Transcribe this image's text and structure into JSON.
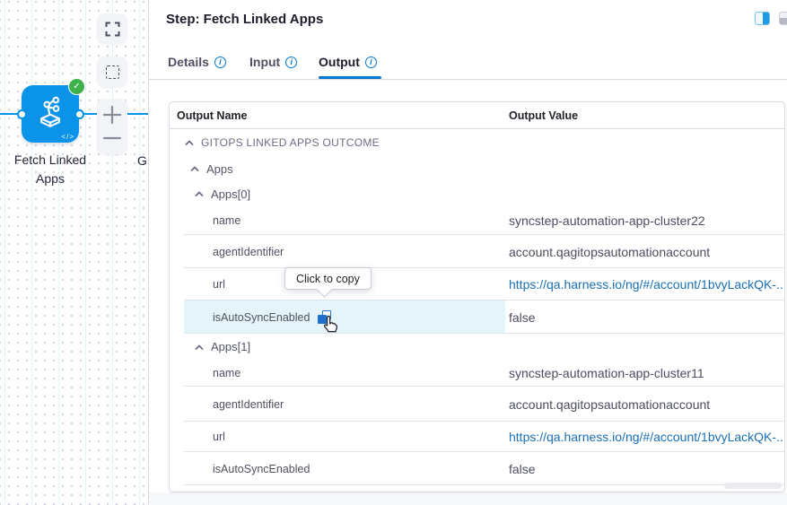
{
  "header": {
    "title": "Step: Fetch Linked Apps"
  },
  "tabs": [
    {
      "label": "Details"
    },
    {
      "label": "Input"
    },
    {
      "label": "Output",
      "active": true
    }
  ],
  "top_icons": {
    "split_pane_blue": "pane-toggle-active",
    "split_pane_grey": "pane-toggle-inactive"
  },
  "canvas": {
    "node_label": "Fetch Linked Apps",
    "node_status": "success",
    "next_node_label_partial": "G",
    "node_code_glyph": "</>",
    "toolbar_icons": [
      "fullscreen-icon",
      "marquee-select-icon",
      "zoom-in-icon",
      "zoom-out-icon"
    ]
  },
  "table": {
    "columns": {
      "name": "Output Name",
      "value": "Output Value"
    },
    "rows": [
      {
        "type": "group",
        "level": 1,
        "label": "GITOPS LINKED APPS OUTCOME"
      },
      {
        "type": "group",
        "level": 2,
        "label": "Apps"
      },
      {
        "type": "group",
        "level": 3,
        "label": "Apps[0]"
      },
      {
        "type": "leaf",
        "label": "name",
        "value": "syncstep-automation-app-cluster22"
      },
      {
        "type": "leaf",
        "label": "agentIdentifier",
        "value": "account.qagitopsautomationaccount"
      },
      {
        "type": "leaf",
        "label": "url",
        "value": "https://qa.harness.io/ng/#/account/1bvyLackQK-...",
        "link": true
      },
      {
        "type": "leaf",
        "label": "isAutoSyncEnabled",
        "value": "false",
        "hovered": true
      },
      {
        "type": "group",
        "level": 3,
        "label": "Apps[1]"
      },
      {
        "type": "leaf",
        "label": "name",
        "value": "syncstep-automation-app-cluster11"
      },
      {
        "type": "leaf",
        "label": "agentIdentifier",
        "value": "account.qagitopsautomationaccount"
      },
      {
        "type": "leaf",
        "label": "url",
        "value": "https://qa.harness.io/ng/#/account/1bvyLackQK-...",
        "link": true
      },
      {
        "type": "leaf",
        "label": "isAutoSyncEnabled",
        "value": "false"
      }
    ]
  },
  "tooltip": {
    "text": "Click to copy"
  },
  "colors": {
    "accent_blue": "#0278d5",
    "node_blue": "#0b93e7",
    "connector_blue": "#0092e4",
    "link_blue": "#1a6fb5",
    "success_green": "#3db24b",
    "row_hover": "#e5f3fb"
  }
}
